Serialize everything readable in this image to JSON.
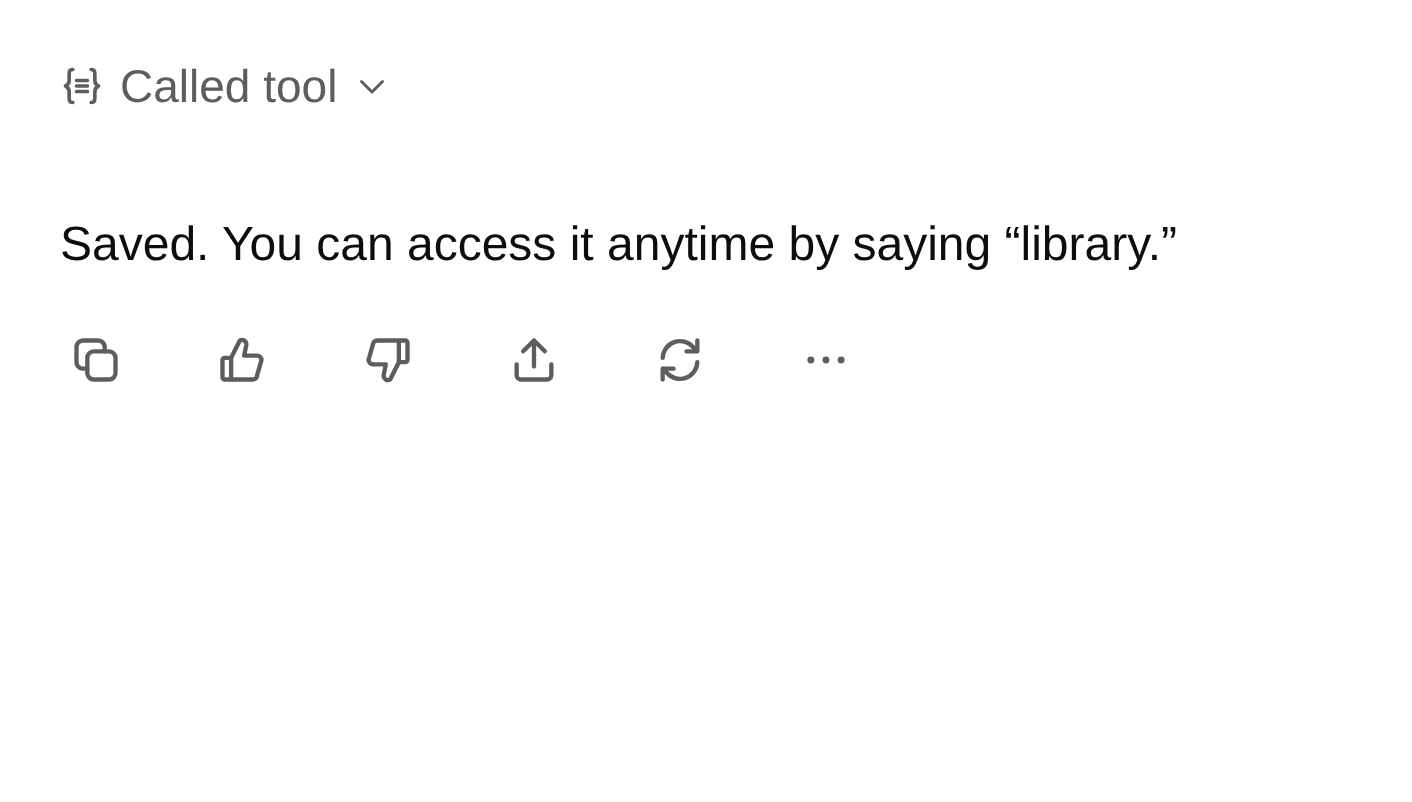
{
  "tool_call": {
    "label": "Called tool",
    "expanded": false
  },
  "message": {
    "text": "Saved. You can access it anytime by saying “library.”"
  },
  "actions": [
    {
      "kind": "copy"
    },
    {
      "kind": "like"
    },
    {
      "kind": "dislike"
    },
    {
      "kind": "share"
    },
    {
      "kind": "regenerate"
    },
    {
      "kind": "more"
    }
  ]
}
